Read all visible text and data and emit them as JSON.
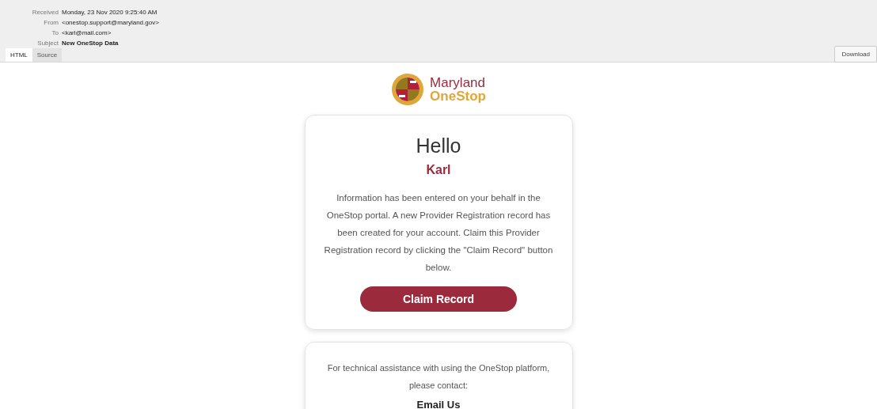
{
  "headers": [
    {
      "label": "Received",
      "value": "Monday, 23 Nov 2020 9:25:40 AM",
      "bold": false
    },
    {
      "label": "From",
      "value": "<onestop.support@maryland.gov>",
      "bold": false
    },
    {
      "label": "To",
      "value": "<karl@mail.com>",
      "bold": false
    },
    {
      "label": "Subject",
      "value": "New OneStop Data",
      "bold": true
    }
  ],
  "tabs": [
    {
      "label": "HTML",
      "selected": true
    },
    {
      "label": "Source",
      "selected": false
    }
  ],
  "download_button": "Download",
  "logo": {
    "line_1": "Maryland",
    "line_2": "OneStop"
  },
  "card": {
    "greeting": "Hello",
    "name": "Karl",
    "message": "Information has been entered on your behalf in the OneStop portal. A new Provider Registration record has been created for your account. Claim this Provider Registration record by clicking the \"Claim Record\" button below.",
    "button": "Claim Record"
  },
  "support_card": {
    "message": "For technical assistance with using the OneStop platform, please contact:",
    "heading": "Email Us"
  }
}
